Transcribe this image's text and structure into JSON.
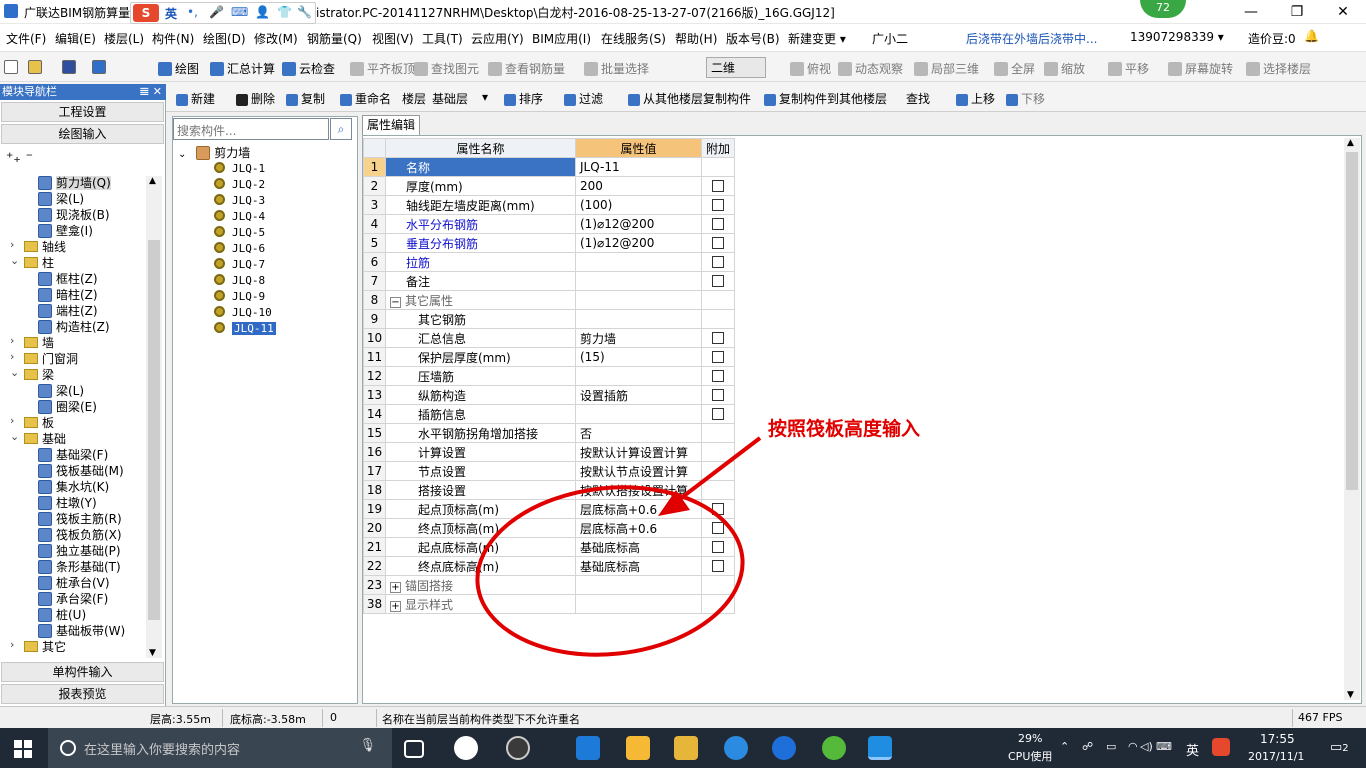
{
  "window": {
    "title_prefix": "广联达BIM钢筋算量",
    "title_suffix": "istrator.PC-20141127NRHM\\Desktop\\白龙村-2016-08-25-13-27-07(2166版)_16G.GGJ12]",
    "minimize": "—",
    "maximize": "❐",
    "close": "✕"
  },
  "ime": {
    "logo": "S",
    "lang": "英"
  },
  "badge": "72",
  "menu": [
    "文件(F)",
    "编辑(E)",
    "楼层(L)",
    "构件(N)",
    "绘图(D)",
    "修改(M)",
    "钢筋量(Q)",
    "视图(V)",
    "工具(T)",
    "云应用(Y)",
    "BIM应用(I)",
    "在线服务(S)",
    "帮助(H)",
    "版本号(B)",
    "新建变更 ▾",
    "广小二",
    "后浇带在外墙后浇带中...",
    "13907298339 ▾",
    "造价豆:0"
  ],
  "toolbar1": [
    "绘图",
    "汇总计算",
    "云检查",
    "平齐板顶",
    "查找图元",
    "查看钢筋量",
    "批量选择",
    "二维",
    "俯视",
    "动态观察",
    "局部三维",
    "全屏",
    "缩放",
    "平移",
    "屏幕旋转",
    "选择楼层"
  ],
  "toolbar2": [
    "新建",
    "删除",
    "复制",
    "重命名",
    "楼层",
    "基础层",
    "排序",
    "过滤",
    "从其他楼层复制构件",
    "复制构件到其他楼层",
    "查找",
    "上移",
    "下移"
  ],
  "nav": {
    "header": "模块导航栏",
    "pin": "𝌆 ✕",
    "btn_project": "工程设置",
    "btn_draw": "绘图输入",
    "btn_single": "单构件输入",
    "btn_report": "报表预览",
    "items": [
      {
        "t": "剪力墙(Q)",
        "lvl": 2
      },
      {
        "t": "梁(L)",
        "lvl": 2
      },
      {
        "t": "现浇板(B)",
        "lvl": 2
      },
      {
        "t": "壁龛(I)",
        "lvl": 2
      },
      {
        "t": "轴线",
        "lvl": 1,
        "tg": "›"
      },
      {
        "t": "柱",
        "lvl": 1,
        "tg": "⌄"
      },
      {
        "t": "框柱(Z)",
        "lvl": 2
      },
      {
        "t": "暗柱(Z)",
        "lvl": 2
      },
      {
        "t": "端柱(Z)",
        "lvl": 2
      },
      {
        "t": "构造柱(Z)",
        "lvl": 2
      },
      {
        "t": "墙",
        "lvl": 1,
        "tg": "›"
      },
      {
        "t": "门窗洞",
        "lvl": 1,
        "tg": "›"
      },
      {
        "t": "梁",
        "lvl": 1,
        "tg": "⌄"
      },
      {
        "t": "梁(L)",
        "lvl": 2
      },
      {
        "t": "圈梁(E)",
        "lvl": 2
      },
      {
        "t": "板",
        "lvl": 1,
        "tg": "›"
      },
      {
        "t": "基础",
        "lvl": 1,
        "tg": "⌄"
      },
      {
        "t": "基础梁(F)",
        "lvl": 2
      },
      {
        "t": "筏板基础(M)",
        "lvl": 2
      },
      {
        "t": "集水坑(K)",
        "lvl": 2
      },
      {
        "t": "柱墩(Y)",
        "lvl": 2
      },
      {
        "t": "筏板主筋(R)",
        "lvl": 2
      },
      {
        "t": "筏板负筋(X)",
        "lvl": 2
      },
      {
        "t": "独立基础(P)",
        "lvl": 2
      },
      {
        "t": "条形基础(T)",
        "lvl": 2
      },
      {
        "t": "桩承台(V)",
        "lvl": 2
      },
      {
        "t": "承台梁(F)",
        "lvl": 2
      },
      {
        "t": "桩(U)",
        "lvl": 2
      },
      {
        "t": "基础板带(W)",
        "lvl": 2
      },
      {
        "t": "其它",
        "lvl": 1,
        "tg": "›"
      }
    ]
  },
  "components": {
    "search_placeholder": "搜索构件...",
    "root": "剪力墙",
    "items": [
      "JLQ-1",
      "JLQ-2",
      "JLQ-3",
      "JLQ-4",
      "JLQ-5",
      "JLQ-6",
      "JLQ-7",
      "JLQ-8",
      "JLQ-9",
      "JLQ-10",
      "JLQ-11"
    ],
    "selected": "JLQ-11"
  },
  "props": {
    "tab": "属性编辑",
    "col_name": "属性名称",
    "col_value": "属性值",
    "col_extra": "附加",
    "rows": [
      {
        "n": "1",
        "name": "名称",
        "val": "JLQ-11",
        "cb": false,
        "style": "sel"
      },
      {
        "n": "2",
        "name": "厚度(mm)",
        "val": "200",
        "cb": true
      },
      {
        "n": "3",
        "name": "轴线距左墙皮距离(mm)",
        "val": "(100)",
        "cb": true
      },
      {
        "n": "4",
        "name": "水平分布钢筋",
        "val": "(1)⌀12@200",
        "cb": true,
        "style": "blue"
      },
      {
        "n": "5",
        "name": "垂直分布钢筋",
        "val": "(1)⌀12@200",
        "cb": true,
        "style": "blue"
      },
      {
        "n": "6",
        "name": "拉筋",
        "val": "",
        "cb": true,
        "style": "blue"
      },
      {
        "n": "7",
        "name": "备注",
        "val": "",
        "cb": true
      },
      {
        "n": "8",
        "name": "其它属性",
        "val": "",
        "cb": false,
        "style": "group",
        "tg": "−"
      },
      {
        "n": "9",
        "name": "其它钢筋",
        "val": "",
        "cb": false,
        "indent": true
      },
      {
        "n": "10",
        "name": "汇总信息",
        "val": "剪力墙",
        "cb": true,
        "indent": true
      },
      {
        "n": "11",
        "name": "保护层厚度(mm)",
        "val": "(15)",
        "cb": true,
        "indent": true
      },
      {
        "n": "12",
        "name": "压墙筋",
        "val": "",
        "cb": true,
        "indent": true
      },
      {
        "n": "13",
        "name": "纵筋构造",
        "val": "设置插筋",
        "cb": true,
        "indent": true
      },
      {
        "n": "14",
        "name": "插筋信息",
        "val": "",
        "cb": true,
        "indent": true
      },
      {
        "n": "15",
        "name": "水平钢筋拐角增加搭接",
        "val": "否",
        "cb": false,
        "indent": true
      },
      {
        "n": "16",
        "name": "计算设置",
        "val": "按默认计算设置计算",
        "cb": false,
        "indent": true
      },
      {
        "n": "17",
        "name": "节点设置",
        "val": "按默认节点设置计算",
        "cb": false,
        "indent": true
      },
      {
        "n": "18",
        "name": "搭接设置",
        "val": "按默认搭接设置计算",
        "cb": false,
        "indent": true
      },
      {
        "n": "19",
        "name": "起点顶标高(m)",
        "val": "层底标高+0.6",
        "cb": true,
        "indent": true
      },
      {
        "n": "20",
        "name": "终点顶标高(m)",
        "val": "层底标高+0.6",
        "cb": true,
        "indent": true
      },
      {
        "n": "21",
        "name": "起点底标高(m)",
        "val": "基础底标高",
        "cb": true,
        "indent": true
      },
      {
        "n": "22",
        "name": "终点底标高(m)",
        "val": "基础底标高",
        "cb": true,
        "indent": true
      },
      {
        "n": "23",
        "name": "锚固搭接",
        "val": "",
        "cb": false,
        "style": "group",
        "tg": "+"
      },
      {
        "n": "38",
        "name": "显示样式",
        "val": "",
        "cb": false,
        "style": "group",
        "tg": "+"
      }
    ]
  },
  "annotation": "按照筏板高度输入",
  "status": {
    "floor_height": "层高:3.55m",
    "base_elev": "底标高:-3.58m",
    "zero": "0",
    "message": "名称在当前层当前构件类型下不允许重名",
    "fps": "467 FPS"
  },
  "taskbar": {
    "search_placeholder": "在这里输入你要搜索的内容",
    "cpu_pct": "29%",
    "cpu_label": "CPU使用",
    "ime": "英",
    "time": "17:55",
    "date": "2017/11/1",
    "notif": "2"
  }
}
